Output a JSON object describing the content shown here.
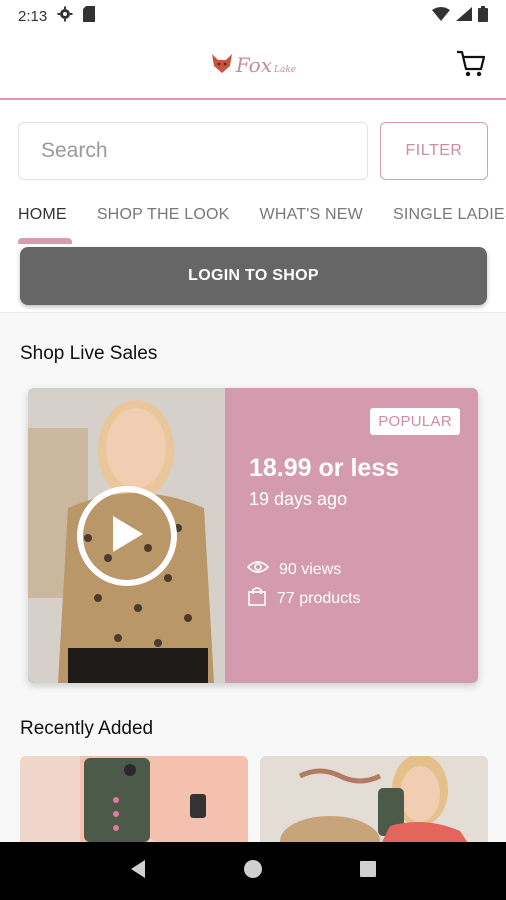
{
  "status_bar": {
    "time": "2:13",
    "icons": [
      "gear-icon",
      "sd-card-icon",
      "wifi-icon",
      "signal-icon",
      "battery-icon"
    ]
  },
  "header": {
    "logo_text": "Fox",
    "logo_subtext": "Lake",
    "cart_icon": "cart-icon"
  },
  "search": {
    "placeholder": "Search",
    "filter_label": "FILTER"
  },
  "tabs": [
    {
      "label": "HOME",
      "active": true
    },
    {
      "label": "SHOP THE LOOK",
      "active": false
    },
    {
      "label": "WHAT'S NEW",
      "active": false
    },
    {
      "label": "SINGLE LADIES",
      "active": false
    }
  ],
  "login": {
    "label": "LOGIN TO SHOP"
  },
  "live_sales": {
    "title": "Shop Live Sales",
    "card": {
      "badge": "POPULAR",
      "price": "18.99 or less",
      "date": "19 days ago",
      "views": "90 views",
      "products": "77 products"
    }
  },
  "recently_added": {
    "title": "Recently Added"
  },
  "colors": {
    "accent_pink": "#d99bb0",
    "card_pink": "#d49aae",
    "login_gray": "#666666"
  }
}
